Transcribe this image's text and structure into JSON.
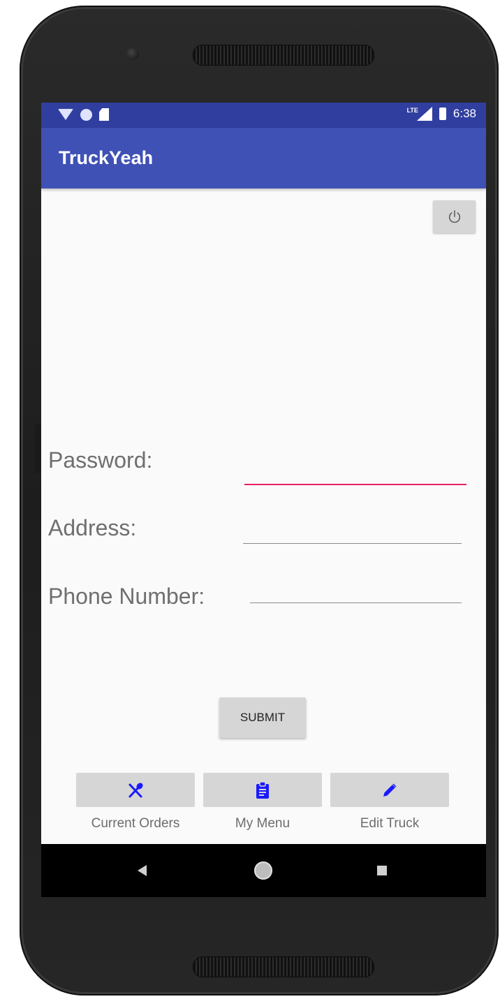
{
  "status_bar": {
    "time": "6:38",
    "network": "LTE"
  },
  "app_bar": {
    "title": "TruckYeah"
  },
  "form": {
    "password_label": "Password:",
    "address_label": "Address:",
    "phone_label": "Phone Number:",
    "password_value": "",
    "address_value": "",
    "phone_value": "",
    "submit_label": "SUBMIT"
  },
  "bottom_nav": {
    "items": [
      {
        "label": "Current Orders",
        "icon": "fork-spoon-icon"
      },
      {
        "label": "My Menu",
        "icon": "clipboard-icon"
      },
      {
        "label": "Edit Truck",
        "icon": "pencil-icon"
      }
    ]
  },
  "colors": {
    "status_bar": "#303f9f",
    "app_bar": "#3f51b5",
    "accent": "#e91e63",
    "nav_icon": "#1a1aff"
  }
}
